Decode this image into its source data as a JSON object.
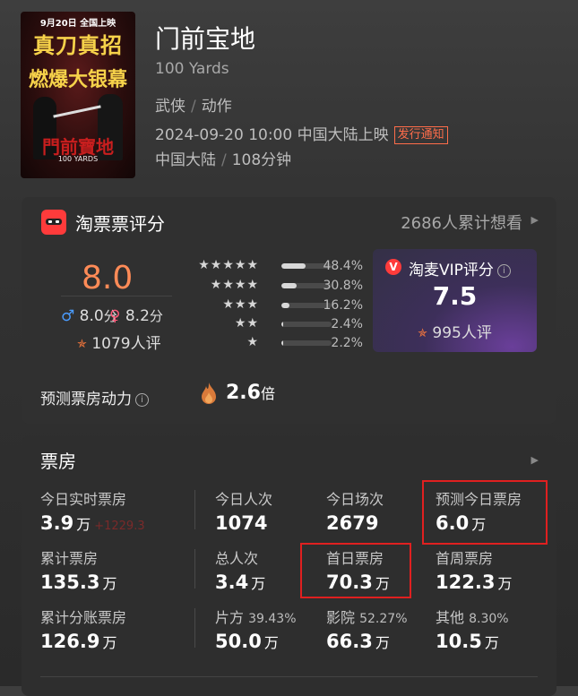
{
  "movie": {
    "poster": {
      "date_line": "9月20日 全国上映",
      "line1": "真刀真招",
      "line2": "燃爆大银幕",
      "title_art": "門前寶地",
      "sub": "100 YARDS"
    },
    "title": "门前宝地",
    "en_title": "100 Yards",
    "genres": [
      "武侠",
      "动作"
    ],
    "release": "2024-09-20 10:00 中国大陆上映",
    "release_badge": "发行通知",
    "region": "中国大陆",
    "duration": "108分钟"
  },
  "rating_card": {
    "title": "淘票票评分",
    "want_count": "2686人累计想看",
    "score": "8.0",
    "male_score": "8.0",
    "female_score": "8.2",
    "score_unit": "分",
    "rating_count": "1079人评",
    "distribution": [
      {
        "stars": "★★★★★",
        "pct_label": "48.4%",
        "fraction": 0.484
      },
      {
        "stars": "★★★★",
        "pct_label": "30.8%",
        "fraction": 0.308
      },
      {
        "stars": "★★★",
        "pct_label": "16.2%",
        "fraction": 0.162
      },
      {
        "stars": "★★",
        "pct_label": "2.4%",
        "fraction": 0.024
      },
      {
        "stars": "★",
        "pct_label": "2.2%",
        "fraction": 0.022
      }
    ],
    "vip": {
      "title": "淘麦VIP评分",
      "score": "7.5",
      "count": "995人评"
    },
    "power_label": "预测票房动力",
    "power_value": "2.6",
    "power_unit": "倍"
  },
  "box_office": {
    "title": "票房",
    "unit": "万",
    "items": {
      "today_realtime": {
        "label": "今日实时票房",
        "value": "3.9",
        "delta": "+1229.3"
      },
      "today_people": {
        "label": "今日人次",
        "value": "1074"
      },
      "today_shows": {
        "label": "今日场次",
        "value": "2679"
      },
      "predict_today": {
        "label": "预测今日票房",
        "value": "6.0"
      },
      "total": {
        "label": "累计票房",
        "value": "135.3"
      },
      "total_people": {
        "label": "总人次",
        "value": "3.4"
      },
      "first_day": {
        "label": "首日票房",
        "value": "70.3"
      },
      "first_week": {
        "label": "首周票房",
        "value": "122.3"
      },
      "split_total": {
        "label": "累计分账票房",
        "value": "126.9"
      },
      "producer": {
        "label": "片方",
        "pct": "39.43%",
        "value": "50.0"
      },
      "cinema": {
        "label": "影院",
        "pct": "52.27%",
        "value": "66.3"
      },
      "other": {
        "label": "其他",
        "pct": "8.30%",
        "value": "10.5"
      }
    }
  },
  "colors": {
    "accent_orange": "#ff8b57",
    "highlight_red": "#e02020",
    "male_blue": "#4a9cff",
    "female_pink": "#ff5a7a"
  }
}
